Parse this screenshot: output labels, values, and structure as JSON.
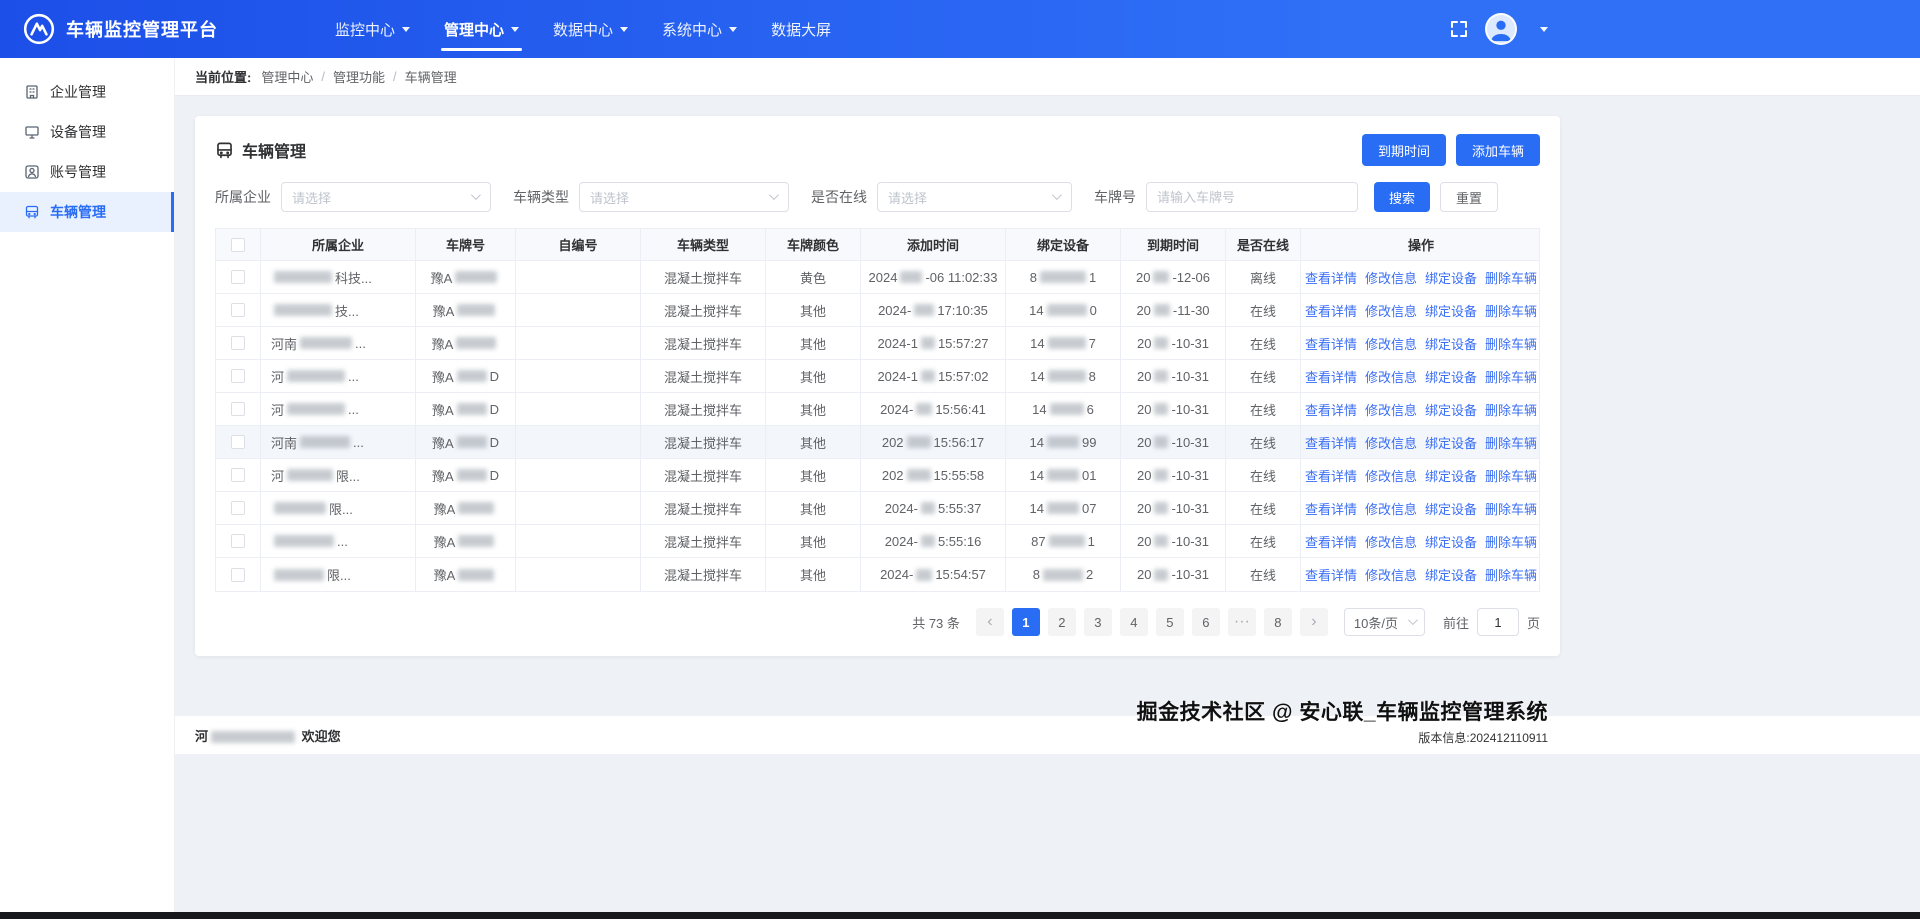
{
  "colors": {
    "primary": "#2a6df5",
    "link": "#3a6ef5",
    "navbar_gradient_start": "#1c4fe8",
    "navbar_gradient_end": "#2f70f7"
  },
  "navbar": {
    "title": "车辆监控管理平台",
    "items": [
      {
        "label": "监控中心",
        "caret": true,
        "active": false
      },
      {
        "label": "管理中心",
        "caret": true,
        "active": true
      },
      {
        "label": "数据中心",
        "caret": true,
        "active": false
      },
      {
        "label": "系统中心",
        "caret": true,
        "active": false
      },
      {
        "label": "数据大屏",
        "caret": false,
        "active": false
      }
    ]
  },
  "sidebar": {
    "items": [
      {
        "label": "企业管理",
        "icon": "enterprise-icon",
        "active": false
      },
      {
        "label": "设备管理",
        "icon": "device-icon",
        "active": false
      },
      {
        "label": "账号管理",
        "icon": "account-icon",
        "active": false
      },
      {
        "label": "车辆管理",
        "icon": "vehicle-icon",
        "active": true
      }
    ]
  },
  "breadcrumb": {
    "prefix": "当前位置:",
    "items": [
      "管理中心",
      "管理功能",
      "车辆管理"
    ]
  },
  "page": {
    "title": "车辆管理",
    "expire_button": "到期时间",
    "add_button": "添加车辆"
  },
  "filters": {
    "company_label": "所属企业",
    "company_placeholder": "请选择",
    "type_label": "车辆类型",
    "type_placeholder": "请选择",
    "online_label": "是否在线",
    "online_placeholder": "请选择",
    "plate_label": "车牌号",
    "plate_placeholder": "请输入车牌号",
    "search_button": "搜索",
    "reset_button": "重置"
  },
  "table": {
    "headers": [
      "所属企业",
      "车牌号",
      "自编号",
      "车辆类型",
      "车牌颜色",
      "添加时间",
      "绑定设备",
      "到期时间",
      "是否在线",
      "操作"
    ],
    "action_labels": [
      "查看详情",
      "修改信息",
      "绑定设备",
      "删除车辆"
    ],
    "rows": [
      {
        "company": [
          {
            "b": 58
          },
          {
            "t": "科技..."
          }
        ],
        "plate": [
          {
            "t": "豫A"
          },
          {
            "b": 42
          }
        ],
        "self_no": "",
        "type": "混凝土搅拌车",
        "color": "黄色",
        "added": [
          {
            "t": "2024"
          },
          {
            "b": 22
          },
          {
            "t": "-06 11:02:33"
          }
        ],
        "device": [
          {
            "t": "8"
          },
          {
            "b": 46
          },
          {
            "t": "1"
          }
        ],
        "expire": [
          {
            "t": "20"
          },
          {
            "b": 16
          },
          {
            "t": "-12-06"
          }
        ],
        "online": "离线",
        "highlight": false
      },
      {
        "company": [
          {
            "b": 58
          },
          {
            "t": "技..."
          }
        ],
        "plate": [
          {
            "t": "豫A"
          },
          {
            "b": 38
          }
        ],
        "self_no": "",
        "type": "混凝土搅拌车",
        "color": "其他",
        "added": [
          {
            "t": "2024-"
          },
          {
            "b": 20
          },
          {
            "t": " 17:10:35"
          }
        ],
        "device": [
          {
            "t": "14"
          },
          {
            "b": 40
          },
          {
            "t": "0"
          }
        ],
        "expire": [
          {
            "t": "20"
          },
          {
            "b": 16
          },
          {
            "t": "-11-30"
          }
        ],
        "online": "在线",
        "highlight": false
      },
      {
        "company": [
          {
            "t": "河南"
          },
          {
            "b": 52
          },
          {
            "t": "..."
          }
        ],
        "plate": [
          {
            "t": "豫A"
          },
          {
            "b": 40
          }
        ],
        "self_no": "",
        "type": "混凝土搅拌车",
        "color": "其他",
        "added": [
          {
            "t": "2024-1"
          },
          {
            "b": 14
          },
          {
            "t": " 15:57:27"
          }
        ],
        "device": [
          {
            "t": "14"
          },
          {
            "b": 38
          },
          {
            "t": "7"
          }
        ],
        "expire": [
          {
            "t": "20"
          },
          {
            "b": 14
          },
          {
            "t": "-10-31"
          }
        ],
        "online": "在线",
        "highlight": false
      },
      {
        "company": [
          {
            "t": "河"
          },
          {
            "b": 58
          },
          {
            "t": "..."
          }
        ],
        "plate": [
          {
            "t": "豫A"
          },
          {
            "b": 30
          },
          {
            "t": "D"
          }
        ],
        "self_no": "",
        "type": "混凝土搅拌车",
        "color": "其他",
        "added": [
          {
            "t": "2024-1"
          },
          {
            "b": 14
          },
          {
            "t": " 15:57:02"
          }
        ],
        "device": [
          {
            "t": "14"
          },
          {
            "b": 38
          },
          {
            "t": "8"
          }
        ],
        "expire": [
          {
            "t": "20"
          },
          {
            "b": 14
          },
          {
            "t": "-10-31"
          }
        ],
        "online": "在线",
        "highlight": false
      },
      {
        "company": [
          {
            "t": "河"
          },
          {
            "b": 58
          },
          {
            "t": "..."
          }
        ],
        "plate": [
          {
            "t": "豫A"
          },
          {
            "b": 30
          },
          {
            "t": "D"
          }
        ],
        "self_no": "",
        "type": "混凝土搅拌车",
        "color": "其他",
        "added": [
          {
            "t": "2024-"
          },
          {
            "b": 16
          },
          {
            "t": " 15:56:41"
          }
        ],
        "device": [
          {
            "t": "14"
          },
          {
            "b": 34
          },
          {
            "t": "6"
          }
        ],
        "expire": [
          {
            "t": "20"
          },
          {
            "b": 14
          },
          {
            "t": "-10-31"
          }
        ],
        "online": "在线",
        "highlight": false
      },
      {
        "company": [
          {
            "t": "河南"
          },
          {
            "b": 50
          },
          {
            "t": "..."
          }
        ],
        "plate": [
          {
            "t": "豫A"
          },
          {
            "b": 30
          },
          {
            "t": "D"
          }
        ],
        "self_no": "",
        "type": "混凝土搅拌车",
        "color": "其他",
        "added": [
          {
            "t": "202"
          },
          {
            "b": 24
          },
          {
            "t": " 15:56:17"
          }
        ],
        "device": [
          {
            "t": "14"
          },
          {
            "b": 32
          },
          {
            "t": "99"
          }
        ],
        "expire": [
          {
            "t": "20"
          },
          {
            "b": 14
          },
          {
            "t": "-10-31"
          }
        ],
        "online": "在线",
        "highlight": true
      },
      {
        "company": [
          {
            "t": "河"
          },
          {
            "b": 46
          },
          {
            "t": "限..."
          }
        ],
        "plate": [
          {
            "t": "豫A"
          },
          {
            "b": 30
          },
          {
            "t": "D"
          }
        ],
        "self_no": "",
        "type": "混凝土搅拌车",
        "color": "其他",
        "added": [
          {
            "t": "202"
          },
          {
            "b": 24
          },
          {
            "t": " 15:55:58"
          }
        ],
        "device": [
          {
            "t": "14"
          },
          {
            "b": 32
          },
          {
            "t": "01"
          }
        ],
        "expire": [
          {
            "t": "20"
          },
          {
            "b": 14
          },
          {
            "t": "-10-31"
          }
        ],
        "online": "在线",
        "highlight": false
      },
      {
        "company": [
          {
            "b": 52
          },
          {
            "t": "限..."
          }
        ],
        "plate": [
          {
            "t": "豫A"
          },
          {
            "b": 36
          }
        ],
        "self_no": "",
        "type": "混凝土搅拌车",
        "color": "其他",
        "added": [
          {
            "t": "2024-"
          },
          {
            "b": 14
          },
          {
            "t": " 5:55:37"
          }
        ],
        "device": [
          {
            "t": "14"
          },
          {
            "b": 32
          },
          {
            "t": "07"
          }
        ],
        "expire": [
          {
            "t": "20"
          },
          {
            "b": 14
          },
          {
            "t": "-10-31"
          }
        ],
        "online": "在线",
        "highlight": false
      },
      {
        "company": [
          {
            "b": 60
          },
          {
            "t": "..."
          }
        ],
        "plate": [
          {
            "t": "豫A"
          },
          {
            "b": 36
          }
        ],
        "self_no": "",
        "type": "混凝土搅拌车",
        "color": "其他",
        "added": [
          {
            "t": "2024-"
          },
          {
            "b": 14
          },
          {
            "t": " 5:55:16"
          }
        ],
        "device": [
          {
            "t": "87"
          },
          {
            "b": 36
          },
          {
            "t": "1"
          }
        ],
        "expire": [
          {
            "t": "20"
          },
          {
            "b": 14
          },
          {
            "t": "-10-31"
          }
        ],
        "online": "在线",
        "highlight": false
      },
      {
        "company": [
          {
            "b": 50
          },
          {
            "t": "限..."
          }
        ],
        "plate": [
          {
            "t": "豫A"
          },
          {
            "b": 36
          }
        ],
        "self_no": "",
        "type": "混凝土搅拌车",
        "color": "其他",
        "added": [
          {
            "t": "2024-"
          },
          {
            "b": 16
          },
          {
            "t": " 15:54:57"
          }
        ],
        "device": [
          {
            "t": "8"
          },
          {
            "b": 40
          },
          {
            "t": "2"
          }
        ],
        "expire": [
          {
            "t": "20"
          },
          {
            "b": 14
          },
          {
            "t": "-10-31"
          }
        ],
        "online": "在线",
        "highlight": false
      }
    ]
  },
  "pagination": {
    "total": "共 73 条",
    "pages": [
      "1",
      "2",
      "3",
      "4",
      "5",
      "6",
      "···",
      "8"
    ],
    "active_page": "1",
    "page_size": "10条/页",
    "goto_label": "前往",
    "goto_value": "1",
    "page_unit": "页"
  },
  "footer": {
    "welcome": [
      {
        "t": "河"
      },
      {
        "b": 84
      },
      {
        "t": " 欢迎您"
      }
    ],
    "watermark_title": "掘金技术社区 @ 安心联_车辆监控管理系统",
    "watermark_version": "版本信息:202412110911"
  }
}
